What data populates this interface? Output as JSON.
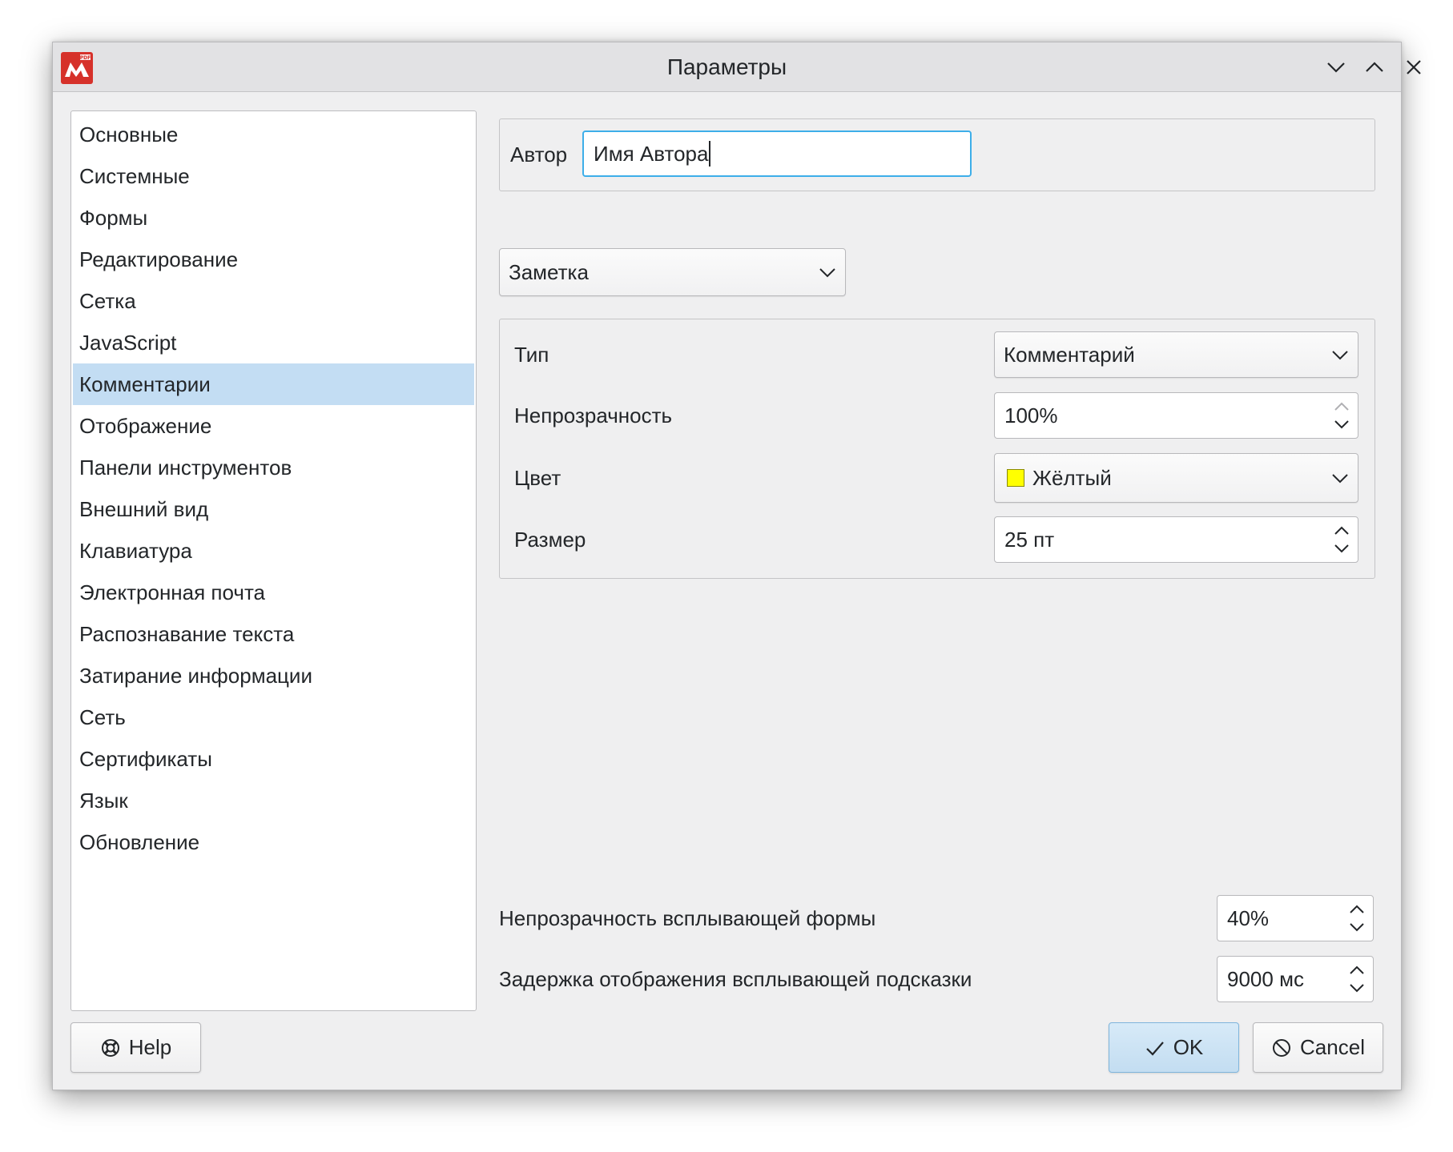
{
  "window": {
    "title": "Параметры",
    "icons": {
      "app": "pdf-app-logo-icon",
      "minimize": "chevron-down-icon",
      "maximize": "chevron-up-icon",
      "close": "close-icon"
    },
    "colors": {
      "logo": "#d6312a",
      "selection": "#c3ddf3",
      "focus": "#3daee9"
    }
  },
  "sidebar": {
    "items": [
      {
        "label": "Основные",
        "selected": false
      },
      {
        "label": "Системные",
        "selected": false
      },
      {
        "label": "Формы",
        "selected": false
      },
      {
        "label": "Редактирование",
        "selected": false
      },
      {
        "label": "Сетка",
        "selected": false
      },
      {
        "label": "JavaScript",
        "selected": false
      },
      {
        "label": "Комментарии",
        "selected": true
      },
      {
        "label": "Отображение",
        "selected": false
      },
      {
        "label": "Панели инструментов",
        "selected": false
      },
      {
        "label": "Внешний вид",
        "selected": false
      },
      {
        "label": "Клавиатура",
        "selected": false
      },
      {
        "label": "Электронная почта",
        "selected": false
      },
      {
        "label": "Распознавание текста",
        "selected": false
      },
      {
        "label": "Затирание информации",
        "selected": false
      },
      {
        "label": "Сеть",
        "selected": false
      },
      {
        "label": "Сертификаты",
        "selected": false
      },
      {
        "label": "Язык",
        "selected": false
      },
      {
        "label": "Обновление",
        "selected": false
      }
    ]
  },
  "author": {
    "label": "Автор",
    "value": "Имя Автора"
  },
  "annotation_type": {
    "selected": "Заметка"
  },
  "properties": {
    "type": {
      "label": "Тип",
      "value": "Комментарий"
    },
    "opacity": {
      "label": "Непрозрачность",
      "value": "100%"
    },
    "color": {
      "label": "Цвет",
      "value": "Жёлтый",
      "swatch": "#ffff00"
    },
    "size": {
      "label": "Размер",
      "value": "25 пт"
    }
  },
  "popup": {
    "opacity": {
      "label": "Непрозрачность всплывающей формы",
      "value": "40%"
    },
    "delay": {
      "label": "Задержка отображения всплывающей подсказки",
      "value": "9000 мс"
    }
  },
  "buttons": {
    "help": {
      "label": "Help",
      "icon": "lifebuoy-icon"
    },
    "ok": {
      "label": "OK",
      "icon": "checkmark-icon"
    },
    "cancel": {
      "label": "Cancel",
      "icon": "cancel-icon"
    }
  }
}
